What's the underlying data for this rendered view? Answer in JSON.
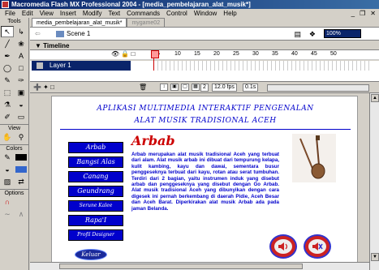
{
  "window": {
    "title": "Macromedia Flash MX Professional 2004 - [media_pembelajaran_alat_musik*]",
    "controls": [
      "_",
      "❐",
      "✕"
    ]
  },
  "menu": [
    "File",
    "Edit",
    "View",
    "Insert",
    "Modify",
    "Text",
    "Commands",
    "Control",
    "Window",
    "Help"
  ],
  "tools": {
    "header": "Tools",
    "view_label": "View",
    "colors_label": "Colors",
    "options_label": "Options"
  },
  "tabs": [
    {
      "label": "media_pembelajaran_alat_musik*",
      "active": true
    },
    {
      "label": "mygame02",
      "active": false
    }
  ],
  "scene": {
    "name": "Scene 1",
    "zoom": "100%"
  },
  "timeline": {
    "header": "Timeline",
    "ruler": [
      "5",
      "10",
      "15",
      "20",
      "25",
      "30",
      "35",
      "40",
      "45",
      "50"
    ],
    "layer": "Layer 1",
    "current_frame": "2",
    "fps": "12.0 fps",
    "time": "0.1s"
  },
  "stage": {
    "title_line1": "APLIKASI MULTIMEDIA INTERAKTIF PENGENALAN",
    "title_line2": "ALAT MUSIK TRADISIONAL ACEH",
    "menu_buttons": [
      "Arbab",
      "Bangsi Alas",
      "Canang",
      "Geundrang",
      "Serune Kalee",
      "Rapa'I",
      "Profil Designer"
    ],
    "heading": "Arbab",
    "paragraph": "Arbab merupakan alat musik tradisional Aceh yang terbuat dari alam. Alat musik arbab ini dibuat dari tempurung kelapa, kulit kambing, kayu dan dawai, sementara busur penggeseknya terbuat dari kayu, rotan atau serat tumbuhan. Terdiri dari 2 bagian, yaitu instrumen induk yang disebut arbab dan penggeseknya yang disebut dengan Go Arbab. Alat musik tradisional Aceh yang dibunyikan dengan cara digesek ini pernah berkembang di daerah Pidie, Aceh Besar dan Aceh Barat. Diperkirakan alat musik Arbab ada pada jaman Belanda.",
    "exit_label": "Keluar"
  },
  "colors": {
    "title_bar": "#0a246a",
    "stage_text": "#0000cc",
    "heading": "#cc0000",
    "button_bg": "#0000cc"
  }
}
